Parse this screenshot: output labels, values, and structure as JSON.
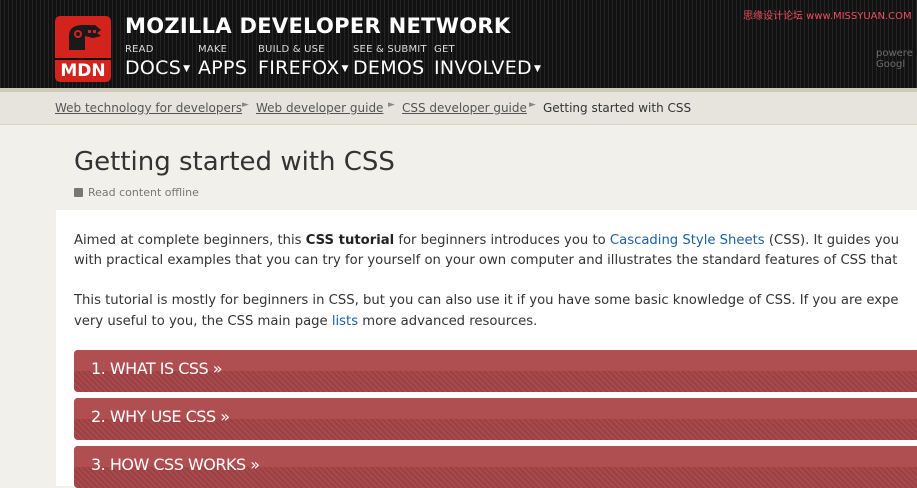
{
  "header": {
    "site_title": "MOZILLA DEVELOPER NETWORK",
    "logo_text": "MDN",
    "nav": [
      {
        "small": "READ",
        "big": "DOCS",
        "caret": true
      },
      {
        "small": "MAKE",
        "big": "APPS",
        "caret": false
      },
      {
        "small": "BUILD & USE",
        "big": "FIREFOX",
        "caret": true
      },
      {
        "small": "SEE & SUBMIT",
        "big": "DEMOS",
        "caret": false
      },
      {
        "small": "GET",
        "big": "INVOLVED",
        "caret": true
      }
    ],
    "watermark": "思缘设计论坛 www.MISSYUAN.COM",
    "powered_by": "powere Googl"
  },
  "breadcrumb": [
    "Web technology for developers",
    "Web developer guide",
    "CSS developer guide",
    "Getting started with CSS"
  ],
  "page": {
    "title": "Getting started with CSS",
    "offline_label": "Read content offline"
  },
  "content": {
    "p1_line1_a": "Aimed at complete beginners, this ",
    "p1_bold": "CSS tutorial",
    "p1_line1_b": " for beginners introduces you to ",
    "p1_link": "Cascading Style Sheets",
    "p1_line1_c": " (CSS). It guides you",
    "p1_line2": "with practical examples that you can try for yourself on your own computer and illustrates the standard features of CSS that",
    "p2_line1": "This tutorial is mostly for beginners in CSS, but you can also use it if you have some basic knowledge of CSS. If you are expe",
    "p2_line2_a": "very useful to you, the CSS main page ",
    "p2_link": "lists",
    "p2_line2_b": " more advanced resources."
  },
  "sections": [
    "1. WHAT IS CSS »",
    "2. WHY USE CSS »",
    "3. HOW CSS WORKS »"
  ],
  "colors": {
    "header_bg": "#1b1b1b",
    "logo_red": "#d4221c",
    "section_red": "#a9484b",
    "link_blue": "#1b5fa6"
  }
}
